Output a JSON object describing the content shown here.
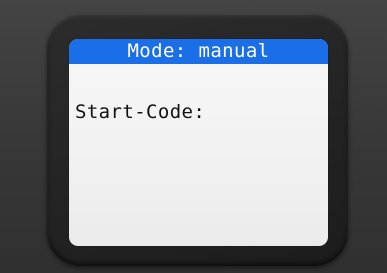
{
  "display": {
    "title": "Mode: manual",
    "start_code_label": "Start-Code:"
  },
  "colors": {
    "title_bar": "#1a6ee8",
    "title_text": "#ffffff",
    "screen_background": "#f1f1f1",
    "body_text": "#111111",
    "bezel": "#262626",
    "background": "#3a3a3a"
  }
}
